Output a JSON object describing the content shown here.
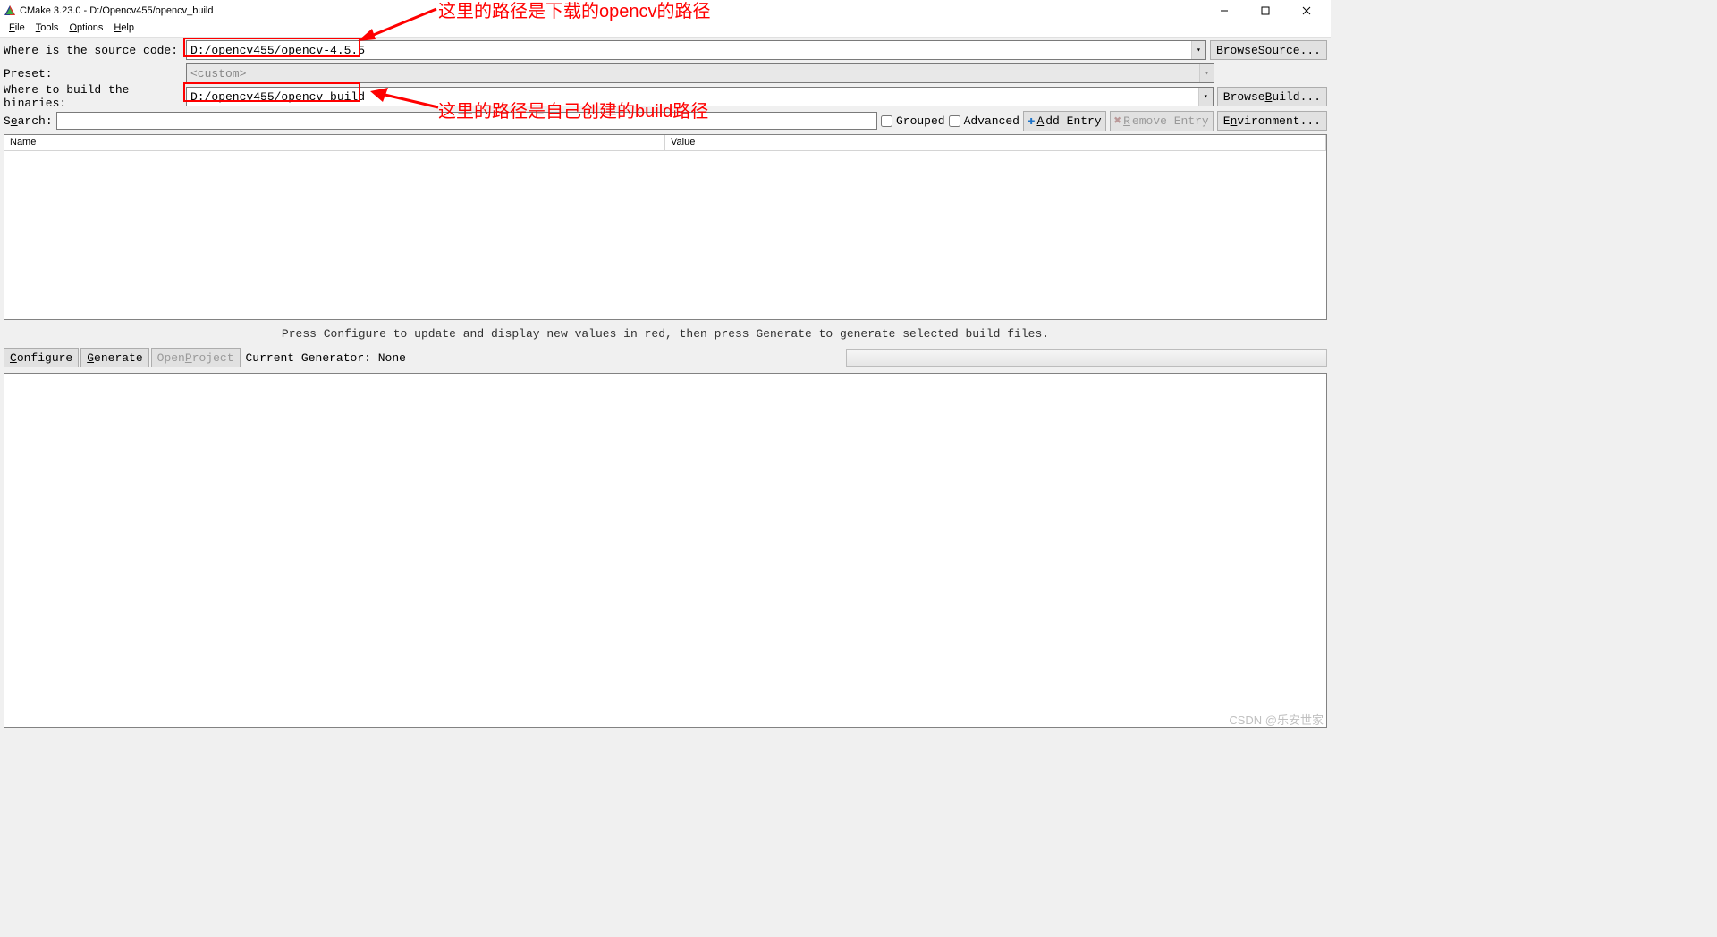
{
  "window": {
    "title": "CMake 3.23.0 - D:/Opencv455/opencv_build"
  },
  "menu": {
    "file": "File",
    "tools": "Tools",
    "options": "Options",
    "help": "Help"
  },
  "form": {
    "source_label": "Where is the source code:",
    "source_value": "D:/opencv455/opencv-4.5.5",
    "browse_source": "Browse Source...",
    "preset_label": "Preset:",
    "preset_value": "<custom>",
    "build_label": "Where to build the binaries:",
    "build_value": "D:/opencv455/opencv_build",
    "browse_build": "Browse Build..."
  },
  "search": {
    "label": "Search:",
    "grouped": "Grouped",
    "advanced": "Advanced",
    "add_entry": "Add Entry",
    "remove_entry": "Remove Entry",
    "environment": "Environment..."
  },
  "table": {
    "name": "Name",
    "value": "Value"
  },
  "message": "Press Configure to update and display new values in red, then press Generate to generate selected build files.",
  "actions": {
    "configure": "Configure",
    "generate": "Generate",
    "open_project": "Open Project",
    "current_gen": "Current Generator: None"
  },
  "annotations": {
    "top": "这里的路径是下载的opencv的路径",
    "bottom": "这里的路径是自己创建的build路径"
  },
  "watermark": "CSDN @乐安世家"
}
